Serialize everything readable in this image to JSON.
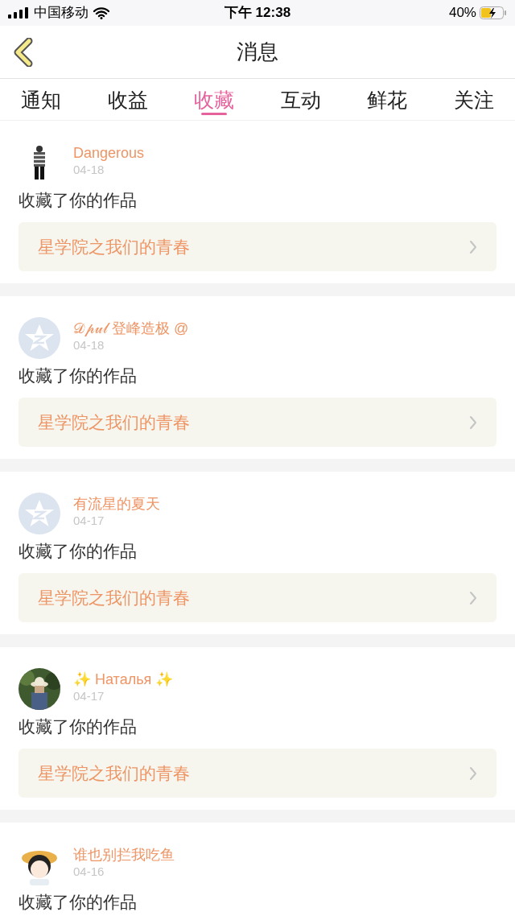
{
  "status_bar": {
    "carrier": "中国移动",
    "time": "下午 12:38",
    "battery": "40%"
  },
  "nav": {
    "title": "消息"
  },
  "tabs": [
    {
      "label": "通知",
      "selected": false
    },
    {
      "label": "收益",
      "selected": false
    },
    {
      "label": "收藏",
      "selected": true
    },
    {
      "label": "互动",
      "selected": false
    },
    {
      "label": "鲜花",
      "selected": false
    },
    {
      "label": "关注",
      "selected": false
    }
  ],
  "messages": [
    {
      "avatar": {
        "kind": "figure"
      },
      "name": "Dangerous",
      "date": "04-18",
      "text": "收藏了你的作品",
      "work": "星学院之我们的青春"
    },
    {
      "avatar": {
        "kind": "default"
      },
      "name": "𝒟𝓅𝓊𝓁 登峰造极 @",
      "date": "04-18",
      "text": "收藏了你的作品",
      "work": "星学院之我们的青春"
    },
    {
      "avatar": {
        "kind": "default"
      },
      "name": "有流星的夏天",
      "date": "04-17",
      "text": "收藏了你的作品",
      "work": "星学院之我们的青春"
    },
    {
      "name": "✨ Наталья ✨",
      "date": "04-17",
      "text": "收藏了你的作品",
      "work": "星学院之我们的青春"
    },
    {
      "avatar": {
        "kind": "cartoon"
      },
      "name": "谁也别拦我吃鱼",
      "date": "04-16",
      "text": "收藏了你的作品"
    }
  ]
}
